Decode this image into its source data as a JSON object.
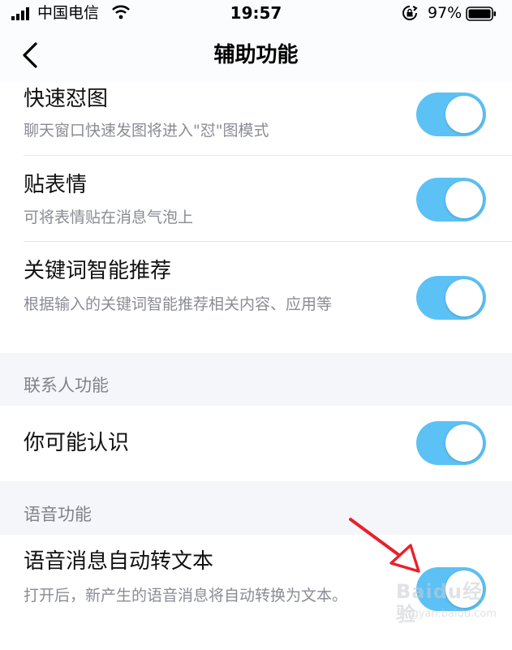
{
  "status_bar": {
    "carrier": "中国电信",
    "time": "19:57",
    "battery_percent": "97%",
    "icons": [
      "signal-icon",
      "wifi-icon",
      "rotation-lock-icon",
      "battery-icon"
    ]
  },
  "nav": {
    "back_icon": "chevron-left-icon",
    "title": "辅助功能"
  },
  "settings": [
    {
      "title": "快速怼图",
      "description": "聊天窗口快速发图将进入\"怼\"图模式",
      "enabled": true
    },
    {
      "title": "贴表情",
      "description": "可将表情贴在消息气泡上",
      "enabled": true
    },
    {
      "title": "关键词智能推荐",
      "description": "根据输入的关键词智能推荐相关内容、应用等",
      "enabled": true
    }
  ],
  "sections": {
    "contacts": {
      "header": "联系人功能",
      "items": [
        {
          "title": "你可能认识",
          "enabled": true
        }
      ]
    },
    "voice": {
      "header": "语音功能",
      "items": [
        {
          "title": "语音消息自动转文本",
          "description": "打开后，新产生的语音消息将自动转换为文本。",
          "enabled": true
        }
      ]
    }
  },
  "watermark": {
    "main": "Baidu经验",
    "sub": "jingyan.baidu.com"
  },
  "colors": {
    "toggle_on": "#5cc1f5",
    "annotation_arrow": "#e8212b",
    "background": "#f5f6fa"
  }
}
